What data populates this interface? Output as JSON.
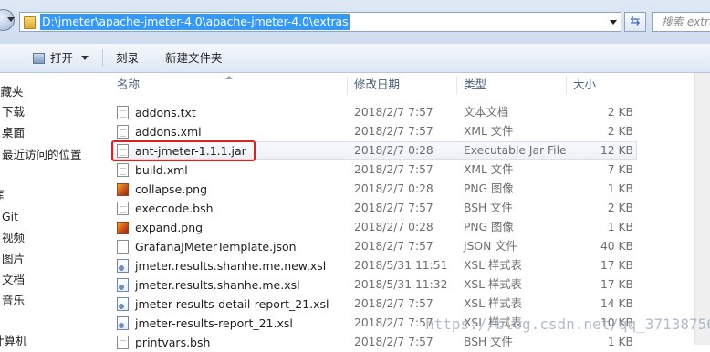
{
  "address": {
    "path": "D:\\jmeter\\apache-jmeter-4.0\\apache-jmeter-4.0\\extras",
    "search_placeholder": "搜索 extras"
  },
  "toolbar": {
    "open_label": "打开",
    "burn_label": "刻录",
    "new_folder_label": "新建文件夹"
  },
  "nav": {
    "items": [
      "收藏夹",
      "下载",
      "桌面",
      "最近访问的位置",
      "库",
      "Git",
      "视频",
      "图片",
      "文档",
      "音乐",
      "计算机"
    ]
  },
  "columns": {
    "name": "名称",
    "date": "修改日期",
    "type": "类型",
    "size": "大小"
  },
  "files": [
    {
      "name": "addons.txt",
      "date": "2018/2/7 7:57",
      "type": "文本文档",
      "size": "2 KB",
      "icon": "text-file-icon"
    },
    {
      "name": "addons.xml",
      "date": "2018/2/7 7:57",
      "type": "XML 文件",
      "size": "2 KB",
      "icon": "xml-file-icon"
    },
    {
      "name": "ant-jmeter-1.1.1.jar",
      "date": "2018/2/7 0:28",
      "type": "Executable Jar File",
      "size": "12 KB",
      "icon": "jar-file-icon"
    },
    {
      "name": "build.xml",
      "date": "2018/2/7 7:57",
      "type": "XML 文件",
      "size": "7 KB",
      "icon": "xml-file-icon"
    },
    {
      "name": "collapse.png",
      "date": "2018/2/7 0:28",
      "type": "PNG 图像",
      "size": "1 KB",
      "icon": "png-image-icon"
    },
    {
      "name": "execcode.bsh",
      "date": "2018/2/7 7:57",
      "type": "BSH 文件",
      "size": "2 KB",
      "icon": "bsh-file-icon"
    },
    {
      "name": "expand.png",
      "date": "2018/2/7 0:28",
      "type": "PNG 图像",
      "size": "1 KB",
      "icon": "png-image-icon"
    },
    {
      "name": "GrafanaJMeterTemplate.json",
      "date": "2018/2/7 7:57",
      "type": "JSON 文件",
      "size": "40 KB",
      "icon": "json-file-icon"
    },
    {
      "name": "jmeter.results.shanhe.me.new.xsl",
      "date": "2018/5/31 11:51",
      "type": "XSL 样式表",
      "size": "17 KB",
      "icon": "xsl-file-icon"
    },
    {
      "name": "jmeter.results.shanhe.me.xsl",
      "date": "2018/5/31 11:32",
      "type": "XSL 样式表",
      "size": "17 KB",
      "icon": "xsl-file-icon"
    },
    {
      "name": "jmeter-results-detail-report_21.xsl",
      "date": "2018/2/7 7:57",
      "type": "XSL 样式表",
      "size": "14 KB",
      "icon": "xsl-file-icon"
    },
    {
      "name": "jmeter-results-report_21.xsl",
      "date": "2018/2/7 7:57",
      "type": "XSL 样式表",
      "size": "10 KB",
      "icon": "xsl-file-icon"
    },
    {
      "name": "printvars.bsh",
      "date": "2018/2/7 7:57",
      "type": "BSH 文件",
      "size": "1 KB",
      "icon": "bsh-file-icon"
    }
  ],
  "watermark": "https://blog.csdn.net/qq_37138756",
  "colors": {
    "address_highlight": "#3399ff",
    "annotation_box": "#e02020",
    "header_text": "#4c607a"
  }
}
